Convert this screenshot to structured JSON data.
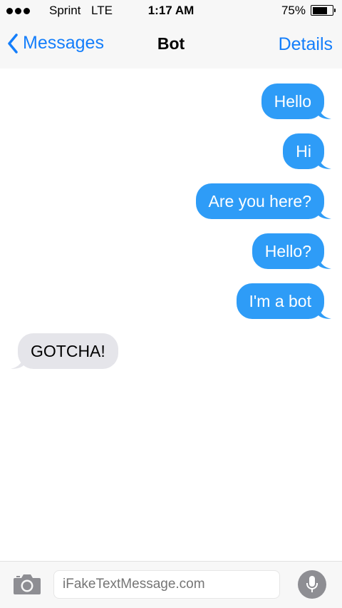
{
  "status_bar": {
    "carrier": "Sprint",
    "network": "LTE",
    "time": "1:17 AM",
    "battery_percent": "75%",
    "battery_level": 0.75,
    "signal_icon": "signal-dots-icon",
    "battery_icon": "battery-icon"
  },
  "nav": {
    "back_label": "Messages",
    "title": "Bot",
    "details_label": "Details",
    "back_icon": "chevron-left-icon"
  },
  "messages": [
    {
      "text": "Hello",
      "direction": "outgoing"
    },
    {
      "text": "Hi",
      "direction": "outgoing"
    },
    {
      "text": "Are you here?",
      "direction": "outgoing"
    },
    {
      "text": "Hello?",
      "direction": "outgoing"
    },
    {
      "text": "I'm a bot",
      "direction": "outgoing"
    },
    {
      "text": "GOTCHA!",
      "direction": "incoming"
    }
  ],
  "input_bar": {
    "placeholder": "iFakeTextMessage.com",
    "camera_icon": "camera-icon",
    "mic_icon": "microphone-icon"
  },
  "colors": {
    "accent": "#147efb",
    "outgoing_bubble": "#2e9cf7",
    "incoming_bubble": "#e5e5ea",
    "bar_background": "#f7f7f7"
  }
}
